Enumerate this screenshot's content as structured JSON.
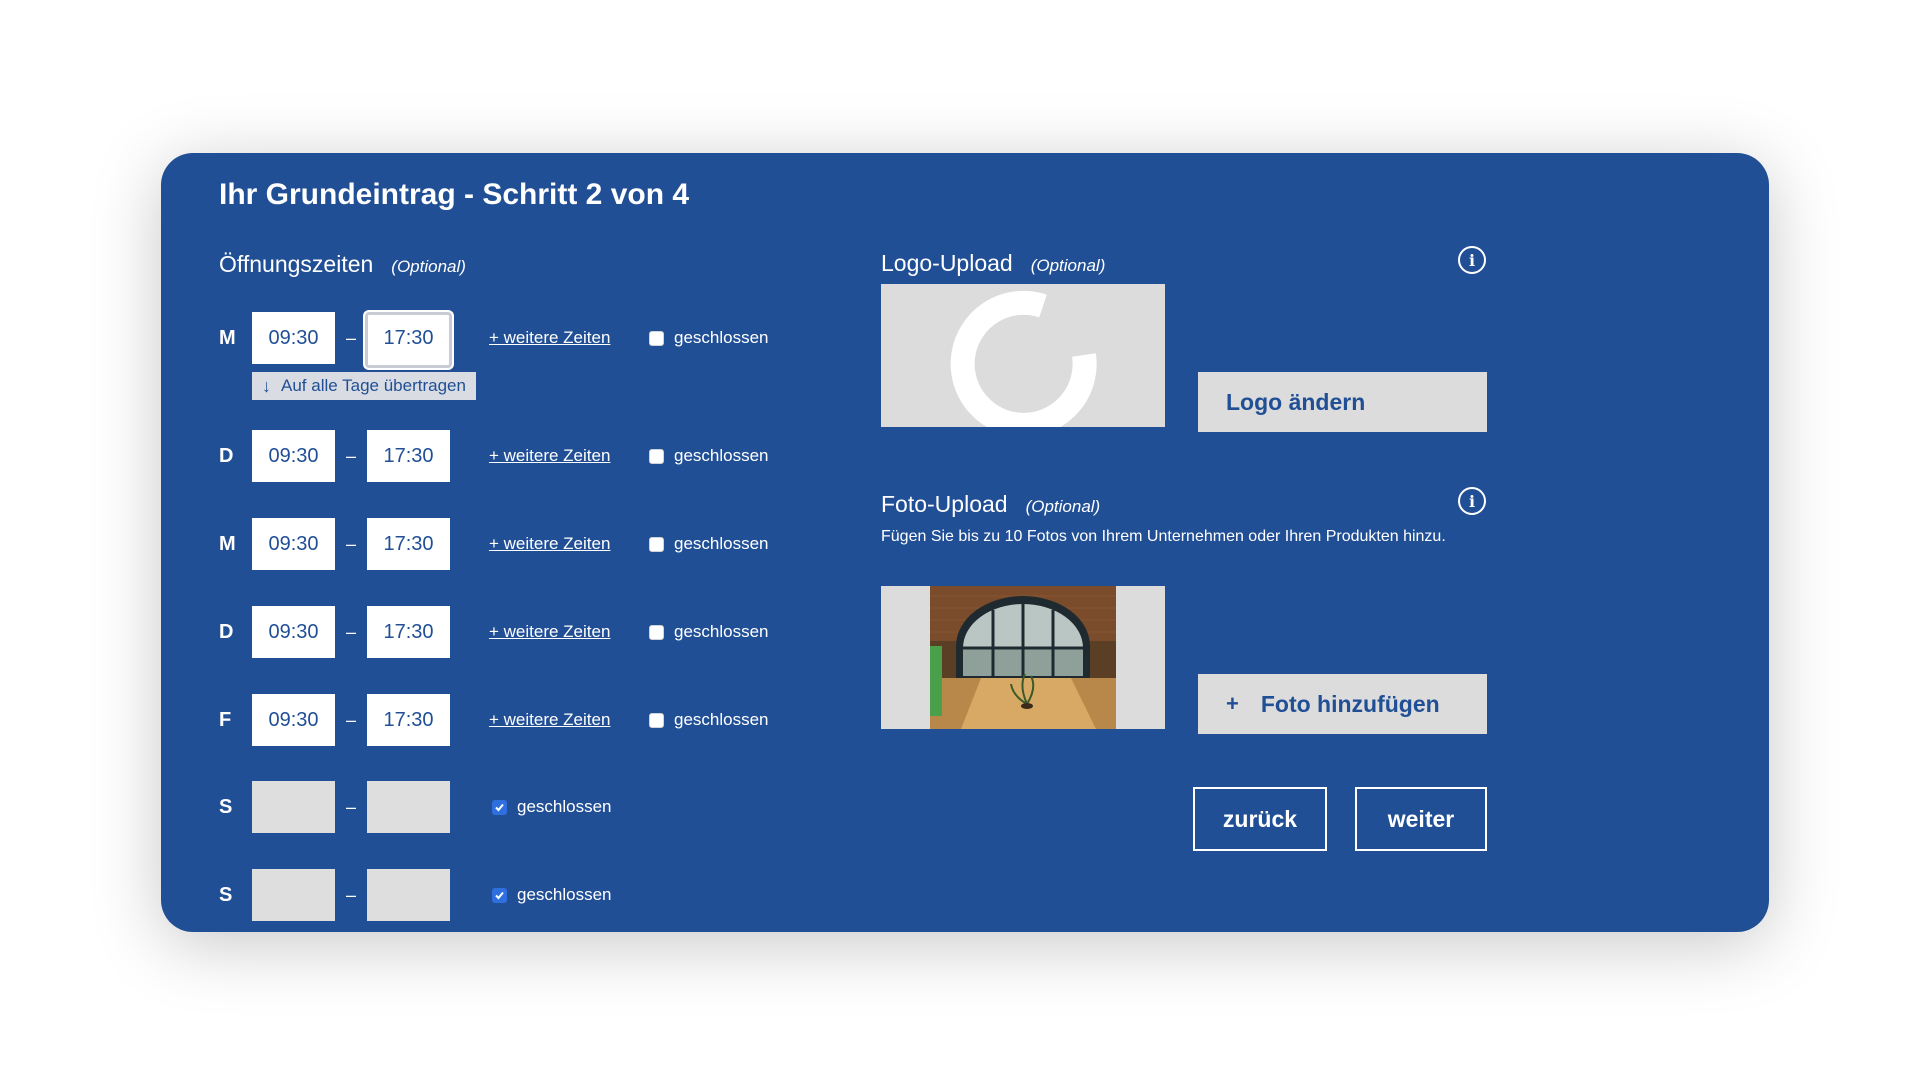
{
  "title": "Ihr Grundeintrag - Schritt 2 von 4",
  "optional_label": "(Optional)",
  "hours": {
    "label": "Öffnungszeiten",
    "copy_all_label": "Auf alle Tage übertragen",
    "copy_all_arrow": "↓",
    "more_times_label": "+ weitere Zeiten",
    "closed_label": "geschlossen",
    "dash": "–",
    "days": [
      {
        "day": "M",
        "from": "09:30",
        "to": "17:30",
        "closed": false
      },
      {
        "day": "D",
        "from": "09:30",
        "to": "17:30",
        "closed": false
      },
      {
        "day": "M",
        "from": "09:30",
        "to": "17:30",
        "closed": false
      },
      {
        "day": "D",
        "from": "09:30",
        "to": "17:30",
        "closed": false
      },
      {
        "day": "F",
        "from": "09:30",
        "to": "17:30",
        "closed": false
      },
      {
        "day": "S",
        "from": "",
        "to": "",
        "closed": true
      },
      {
        "day": "S",
        "from": "",
        "to": "",
        "closed": true
      }
    ]
  },
  "logo": {
    "label": "Logo-Upload",
    "change_button": "Logo ändern"
  },
  "photo": {
    "label": "Foto-Upload",
    "description": "Fügen Sie bis zu 10 Fotos von Ihrem Unternehmen oder Ihren Produkten hinzu.",
    "add_button": "Foto hinzufügen",
    "add_icon": "+"
  },
  "nav": {
    "back": "zurück",
    "next": "weiter"
  },
  "info_icon_glyph": "i",
  "colors": {
    "panel": "#214f96",
    "button_bg": "#dcdcdc",
    "checkbox_checked": "#2f6fe0"
  }
}
